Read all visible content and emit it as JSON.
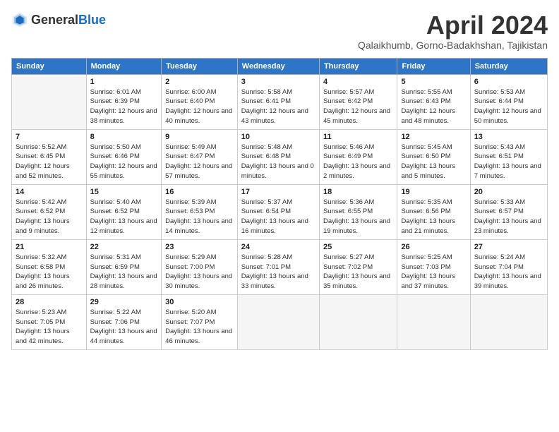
{
  "header": {
    "logo_general": "General",
    "logo_blue": "Blue",
    "title": "April 2024",
    "subtitle": "Qalaikhumb, Gorno-Badakhshan, Tajikistan"
  },
  "columns": [
    "Sunday",
    "Monday",
    "Tuesday",
    "Wednesday",
    "Thursday",
    "Friday",
    "Saturday"
  ],
  "weeks": [
    [
      {
        "day": "",
        "sunrise": "",
        "sunset": "",
        "daylight": "",
        "empty": true
      },
      {
        "day": "1",
        "sunrise": "Sunrise: 6:01 AM",
        "sunset": "Sunset: 6:39 PM",
        "daylight": "Daylight: 12 hours and 38 minutes."
      },
      {
        "day": "2",
        "sunrise": "Sunrise: 6:00 AM",
        "sunset": "Sunset: 6:40 PM",
        "daylight": "Daylight: 12 hours and 40 minutes."
      },
      {
        "day": "3",
        "sunrise": "Sunrise: 5:58 AM",
        "sunset": "Sunset: 6:41 PM",
        "daylight": "Daylight: 12 hours and 43 minutes."
      },
      {
        "day": "4",
        "sunrise": "Sunrise: 5:57 AM",
        "sunset": "Sunset: 6:42 PM",
        "daylight": "Daylight: 12 hours and 45 minutes."
      },
      {
        "day": "5",
        "sunrise": "Sunrise: 5:55 AM",
        "sunset": "Sunset: 6:43 PM",
        "daylight": "Daylight: 12 hours and 48 minutes."
      },
      {
        "day": "6",
        "sunrise": "Sunrise: 5:53 AM",
        "sunset": "Sunset: 6:44 PM",
        "daylight": "Daylight: 12 hours and 50 minutes."
      }
    ],
    [
      {
        "day": "7",
        "sunrise": "Sunrise: 5:52 AM",
        "sunset": "Sunset: 6:45 PM",
        "daylight": "Daylight: 12 hours and 52 minutes."
      },
      {
        "day": "8",
        "sunrise": "Sunrise: 5:50 AM",
        "sunset": "Sunset: 6:46 PM",
        "daylight": "Daylight: 12 hours and 55 minutes."
      },
      {
        "day": "9",
        "sunrise": "Sunrise: 5:49 AM",
        "sunset": "Sunset: 6:47 PM",
        "daylight": "Daylight: 12 hours and 57 minutes."
      },
      {
        "day": "10",
        "sunrise": "Sunrise: 5:48 AM",
        "sunset": "Sunset: 6:48 PM",
        "daylight": "Daylight: 13 hours and 0 minutes."
      },
      {
        "day": "11",
        "sunrise": "Sunrise: 5:46 AM",
        "sunset": "Sunset: 6:49 PM",
        "daylight": "Daylight: 13 hours and 2 minutes."
      },
      {
        "day": "12",
        "sunrise": "Sunrise: 5:45 AM",
        "sunset": "Sunset: 6:50 PM",
        "daylight": "Daylight: 13 hours and 5 minutes."
      },
      {
        "day": "13",
        "sunrise": "Sunrise: 5:43 AM",
        "sunset": "Sunset: 6:51 PM",
        "daylight": "Daylight: 13 hours and 7 minutes."
      }
    ],
    [
      {
        "day": "14",
        "sunrise": "Sunrise: 5:42 AM",
        "sunset": "Sunset: 6:52 PM",
        "daylight": "Daylight: 13 hours and 9 minutes."
      },
      {
        "day": "15",
        "sunrise": "Sunrise: 5:40 AM",
        "sunset": "Sunset: 6:52 PM",
        "daylight": "Daylight: 13 hours and 12 minutes."
      },
      {
        "day": "16",
        "sunrise": "Sunrise: 5:39 AM",
        "sunset": "Sunset: 6:53 PM",
        "daylight": "Daylight: 13 hours and 14 minutes."
      },
      {
        "day": "17",
        "sunrise": "Sunrise: 5:37 AM",
        "sunset": "Sunset: 6:54 PM",
        "daylight": "Daylight: 13 hours and 16 minutes."
      },
      {
        "day": "18",
        "sunrise": "Sunrise: 5:36 AM",
        "sunset": "Sunset: 6:55 PM",
        "daylight": "Daylight: 13 hours and 19 minutes."
      },
      {
        "day": "19",
        "sunrise": "Sunrise: 5:35 AM",
        "sunset": "Sunset: 6:56 PM",
        "daylight": "Daylight: 13 hours and 21 minutes."
      },
      {
        "day": "20",
        "sunrise": "Sunrise: 5:33 AM",
        "sunset": "Sunset: 6:57 PM",
        "daylight": "Daylight: 13 hours and 23 minutes."
      }
    ],
    [
      {
        "day": "21",
        "sunrise": "Sunrise: 5:32 AM",
        "sunset": "Sunset: 6:58 PM",
        "daylight": "Daylight: 13 hours and 26 minutes."
      },
      {
        "day": "22",
        "sunrise": "Sunrise: 5:31 AM",
        "sunset": "Sunset: 6:59 PM",
        "daylight": "Daylight: 13 hours and 28 minutes."
      },
      {
        "day": "23",
        "sunrise": "Sunrise: 5:29 AM",
        "sunset": "Sunset: 7:00 PM",
        "daylight": "Daylight: 13 hours and 30 minutes."
      },
      {
        "day": "24",
        "sunrise": "Sunrise: 5:28 AM",
        "sunset": "Sunset: 7:01 PM",
        "daylight": "Daylight: 13 hours and 33 minutes."
      },
      {
        "day": "25",
        "sunrise": "Sunrise: 5:27 AM",
        "sunset": "Sunset: 7:02 PM",
        "daylight": "Daylight: 13 hours and 35 minutes."
      },
      {
        "day": "26",
        "sunrise": "Sunrise: 5:25 AM",
        "sunset": "Sunset: 7:03 PM",
        "daylight": "Daylight: 13 hours and 37 minutes."
      },
      {
        "day": "27",
        "sunrise": "Sunrise: 5:24 AM",
        "sunset": "Sunset: 7:04 PM",
        "daylight": "Daylight: 13 hours and 39 minutes."
      }
    ],
    [
      {
        "day": "28",
        "sunrise": "Sunrise: 5:23 AM",
        "sunset": "Sunset: 7:05 PM",
        "daylight": "Daylight: 13 hours and 42 minutes."
      },
      {
        "day": "29",
        "sunrise": "Sunrise: 5:22 AM",
        "sunset": "Sunset: 7:06 PM",
        "daylight": "Daylight: 13 hours and 44 minutes."
      },
      {
        "day": "30",
        "sunrise": "Sunrise: 5:20 AM",
        "sunset": "Sunset: 7:07 PM",
        "daylight": "Daylight: 13 hours and 46 minutes."
      },
      {
        "day": "",
        "sunrise": "",
        "sunset": "",
        "daylight": "",
        "empty": true
      },
      {
        "day": "",
        "sunrise": "",
        "sunset": "",
        "daylight": "",
        "empty": true
      },
      {
        "day": "",
        "sunrise": "",
        "sunset": "",
        "daylight": "",
        "empty": true
      },
      {
        "day": "",
        "sunrise": "",
        "sunset": "",
        "daylight": "",
        "empty": true
      }
    ]
  ]
}
